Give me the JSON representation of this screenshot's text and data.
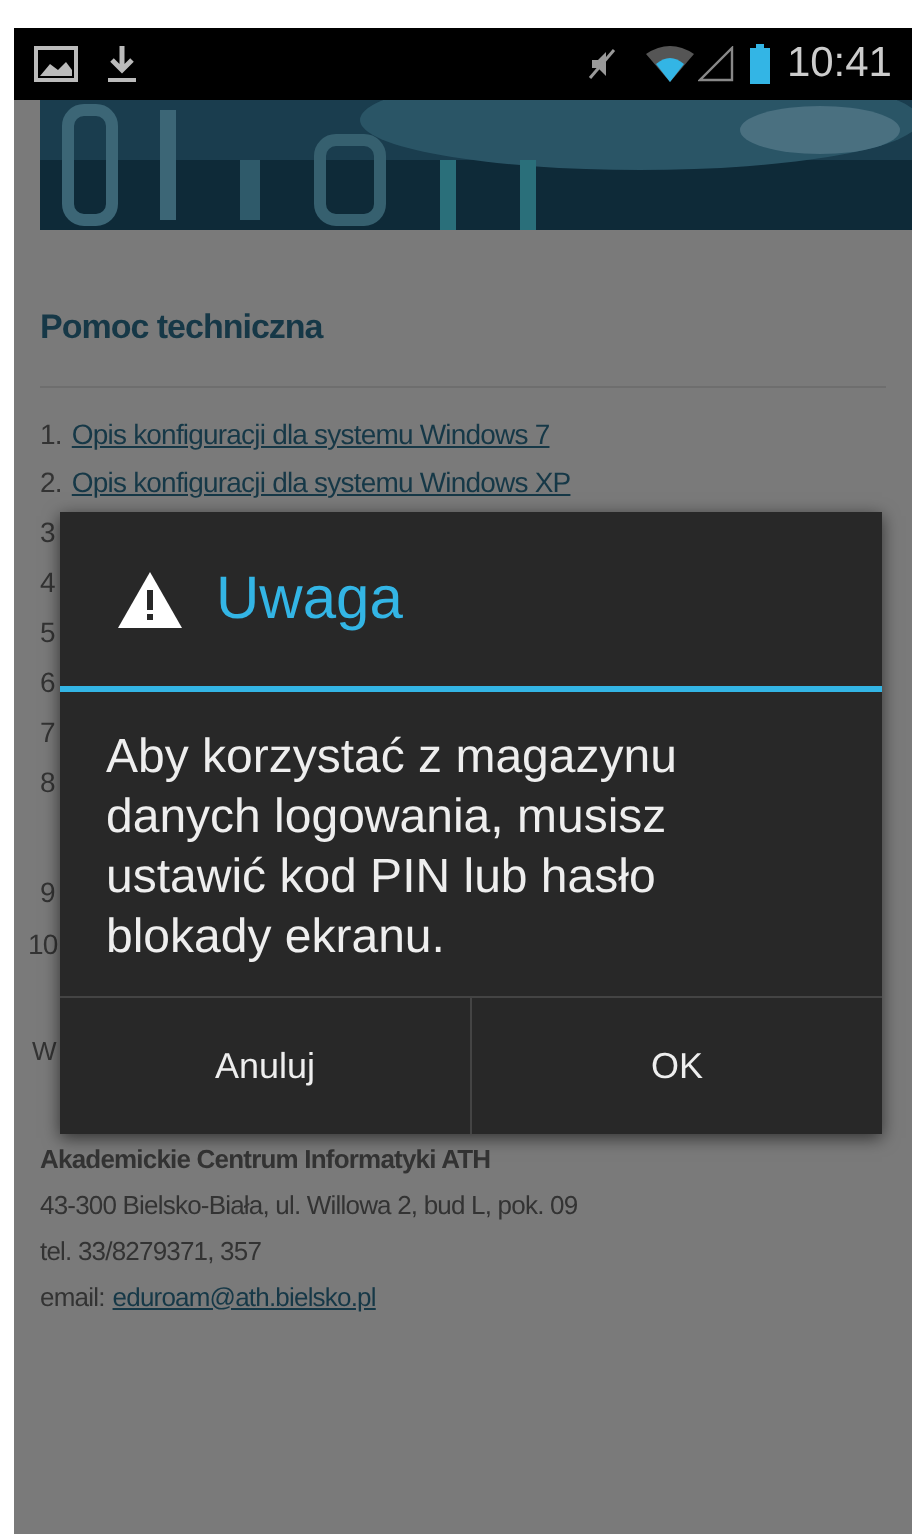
{
  "status_bar": {
    "time": "10:41"
  },
  "page": {
    "heading": "Pomoc techniczna",
    "links": [
      {
        "number": "1.",
        "text": "Opis konfiguracji dla systemu Windows 7"
      },
      {
        "number": "2.",
        "text": "Opis konfiguracji dla systemu Windows XP"
      }
    ],
    "hidden_numbers": [
      "3",
      "4",
      "5",
      "6",
      "7",
      "8"
    ],
    "more_numbers": [
      "9",
      "10"
    ],
    "section_fragment": "W",
    "contact": {
      "name": "Akademickie Centrum Informatyki ATH",
      "address": "43-300 Bielsko-Biała, ul. Willowa 2, bud L, pok. 09",
      "phone": "tel. 33/8279371, 357",
      "email_label": "email:",
      "email": "eduroam@ath.bielsko.pl"
    }
  },
  "dialog": {
    "title": "Uwaga",
    "message": "Aby korzystać z magazynu danych logowania, musisz ustawić kod PIN lub hasło blokady ekranu.",
    "buttons": [
      "Anuluj",
      "OK"
    ]
  }
}
